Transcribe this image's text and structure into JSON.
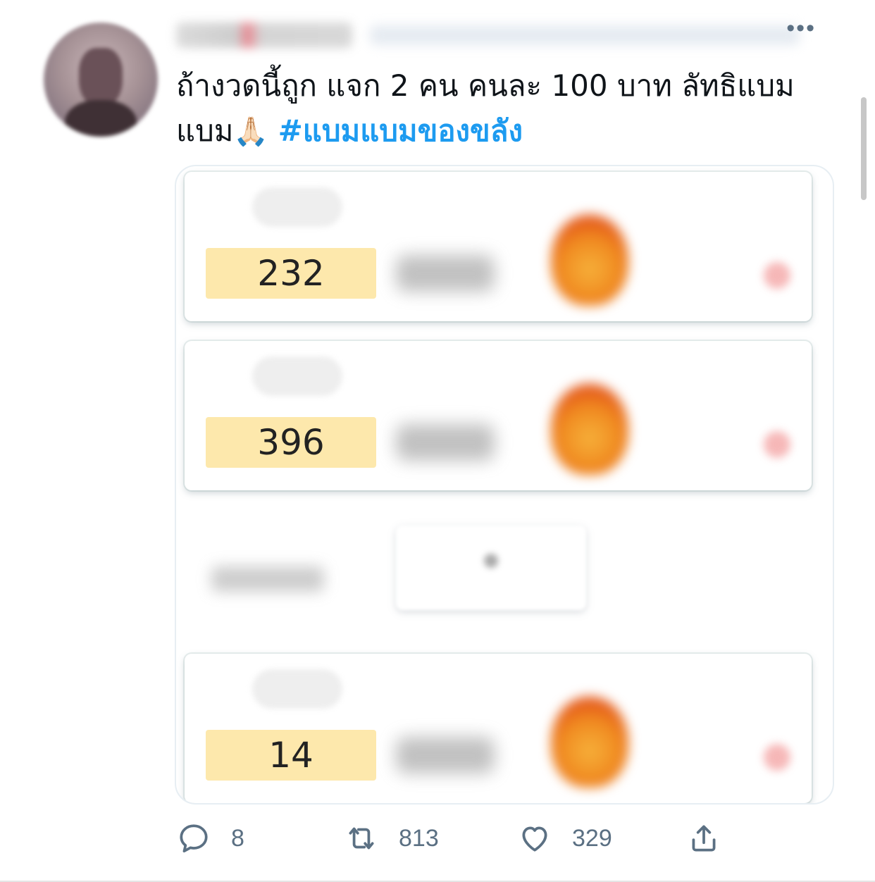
{
  "tweet": {
    "more_label": "•••",
    "text_line1": "ถ้างวดนี้ถูก แจก 2 คน คนละ 100 บาท ลัทธิแบม",
    "text_line2_prefix": "แบม",
    "emoji": "🙏🏻",
    "hashtag": "#แบมแบมของขลัง"
  },
  "media": {
    "cards": [
      {
        "number": "232",
        "icon": "fire-icon"
      },
      {
        "number": "396",
        "icon": "fire-icon"
      },
      {
        "number": "14",
        "icon": "fire-icon"
      }
    ]
  },
  "actions": {
    "reply_count": "8",
    "retweet_count": "813",
    "like_count": "329"
  },
  "colors": {
    "hashtag": "#1d9bf0",
    "action_icon": "#5b7083",
    "number_box": "#fde8ac"
  }
}
